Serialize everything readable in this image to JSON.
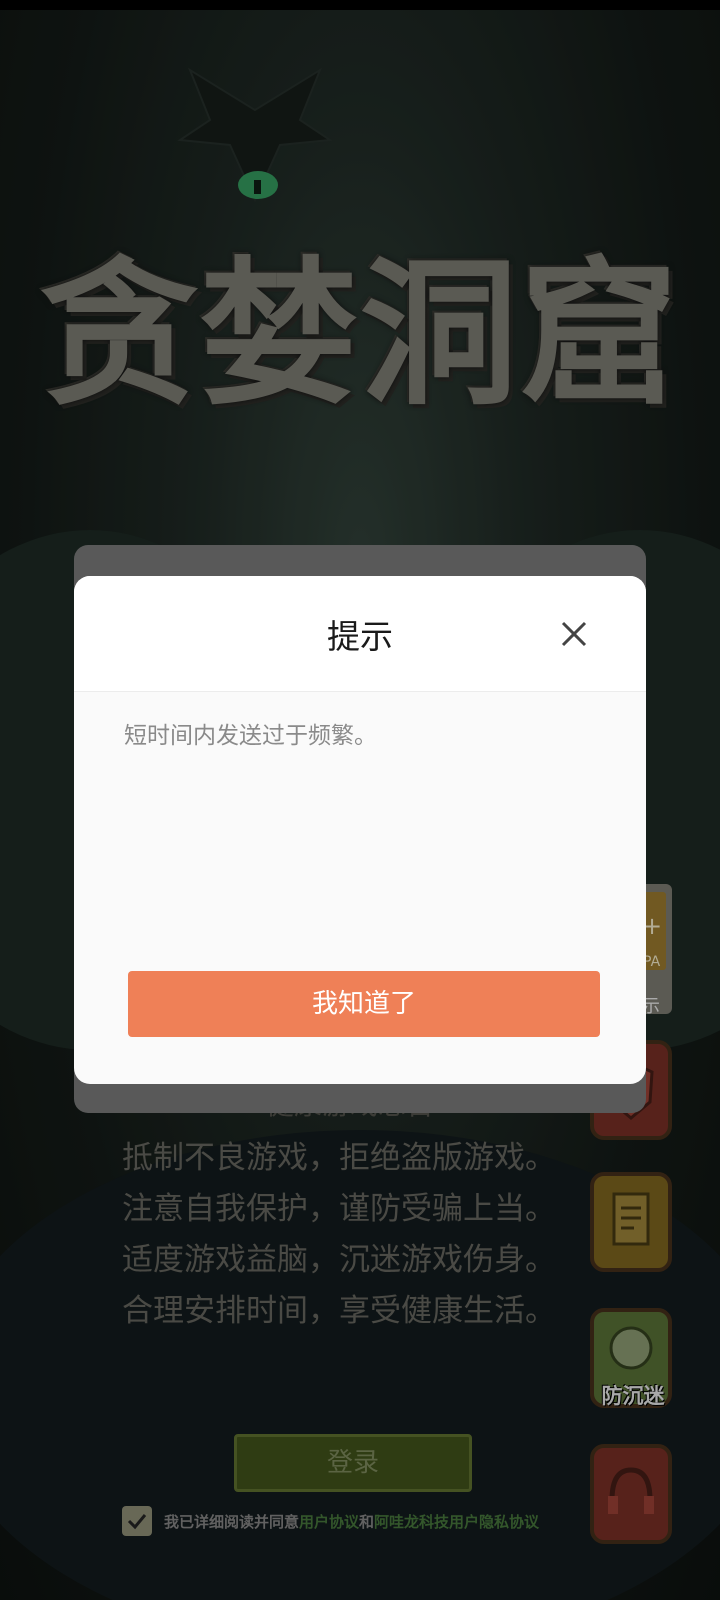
{
  "game": {
    "title": "贪婪洞窟",
    "health_notice": {
      "title": "健康游戏忠告",
      "lines": [
        "抵制不良游戏，拒绝盗版游戏。",
        "注意自我保护，谨防受骗上当。",
        "适度游戏益脑，沉迷游戏伤身。",
        "合理安排时间，享受健康生活。"
      ]
    },
    "age_badge": {
      "plus": "+",
      "sub": "OPA",
      "tip": "提示"
    },
    "side_buttons": [
      {
        "icon": "shield-icon",
        "label": ""
      },
      {
        "icon": "document-icon",
        "label": ""
      },
      {
        "icon": "anti-addiction-icon",
        "label": "防沉迷"
      },
      {
        "icon": "headset-icon",
        "label": ""
      }
    ],
    "login_label": "登录",
    "agreement": {
      "prefix": "我已详细阅读并同意",
      "link1": "用户协议",
      "and": "和",
      "link2": "阿哇龙科技用户隐私协议"
    }
  },
  "dialog": {
    "title": "提示",
    "message": "短时间内发送过于频繁。",
    "confirm_label": "我知道了",
    "close_icon": "close-icon"
  },
  "colors": {
    "confirm": "#ef8057",
    "dialog_bg": "#fafafa"
  }
}
